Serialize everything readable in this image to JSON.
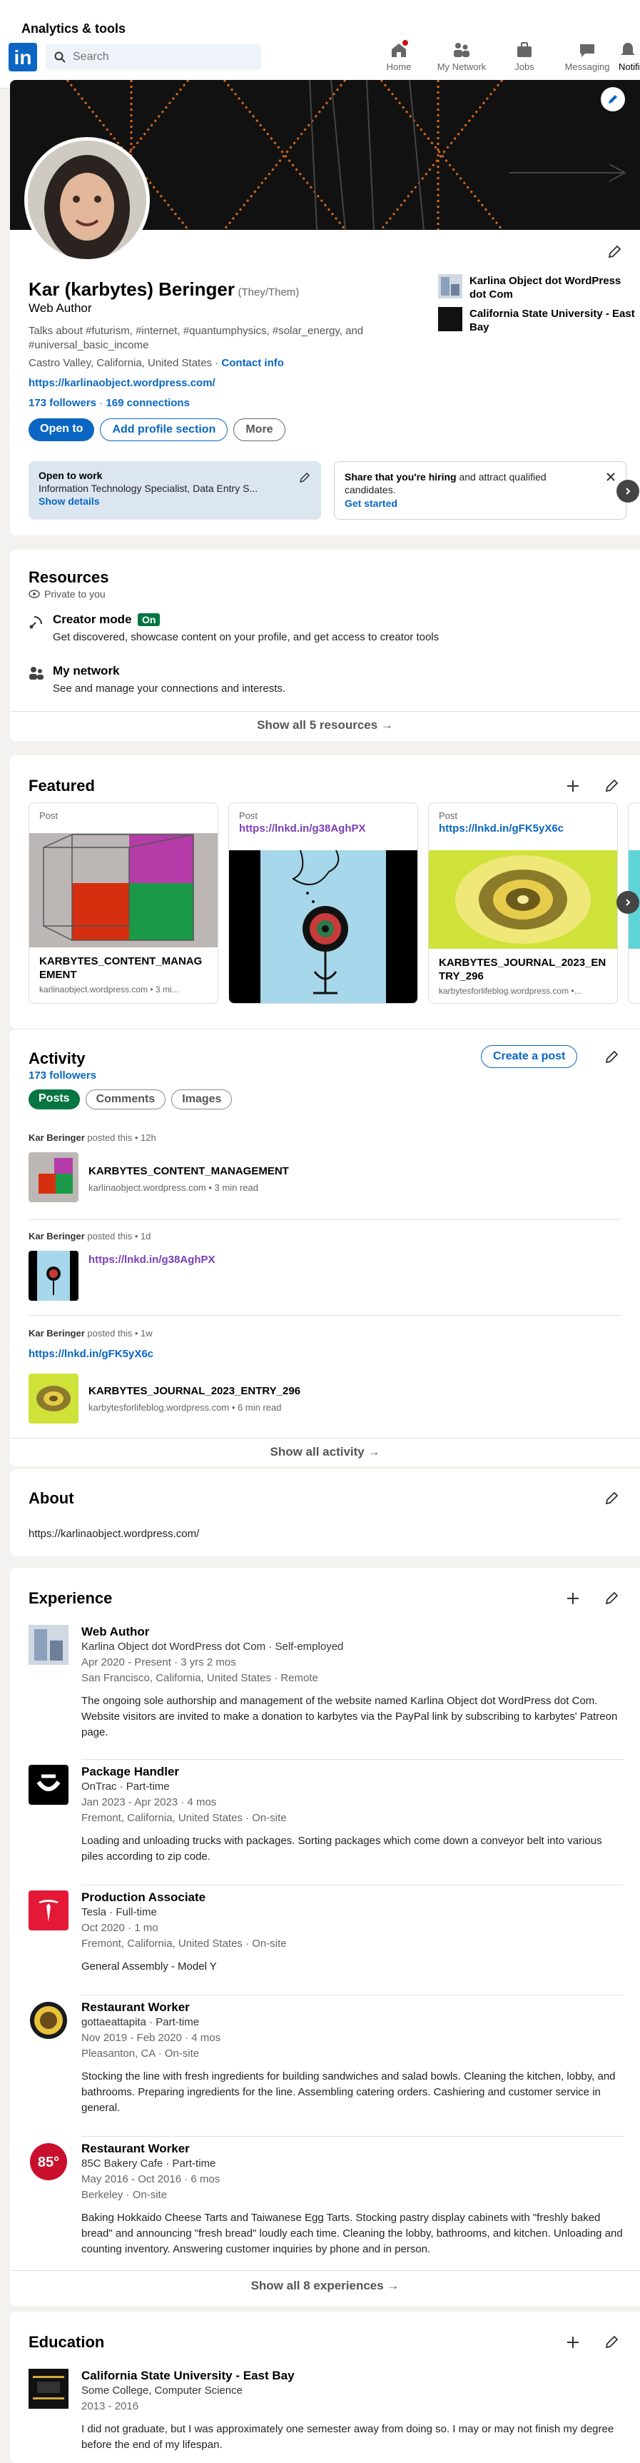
{
  "header": {
    "analytics": "Analytics & tools",
    "logo": "in",
    "search_placeholder": "Search",
    "nav": [
      {
        "label": "Home",
        "icon": "home-icon"
      },
      {
        "label": "My Network",
        "icon": "network-icon"
      },
      {
        "label": "Jobs",
        "icon": "jobs-icon"
      },
      {
        "label": "Messaging",
        "icon": "messaging-icon"
      },
      {
        "label": "Notifi",
        "icon": "notifications-icon"
      }
    ]
  },
  "profile": {
    "name": "Kar (karbytes) Beringer",
    "pronouns": "(They/Them)",
    "headline": "Web Author",
    "about_line": "Talks about #futurism, #internet, #quantumphysics, #solar_energy, and #universal_basic_income",
    "location": "Castro Valley, California, United States",
    "contact_info": "Contact info",
    "website": "https://karlinaobject.wordpress.com/",
    "followers": "173 followers",
    "connections": "169 connections",
    "open_to": "Open to",
    "add_section": "Add profile section",
    "more": "More",
    "companies": [
      "Karlina Object dot WordPress dot Com",
      "California State University - East Bay"
    ],
    "open_to_work_title": "Open to work",
    "open_to_work_desc": "Information Technology Specialist, Data Entry S...",
    "show_details": "Show details",
    "hiring_bold": "Share that you're hiring",
    "hiring_rest": " and attract qualified candidates.",
    "get_started": "Get started"
  },
  "resources": {
    "title": "Resources",
    "private": "Private to you",
    "creator_title": "Creator mode",
    "creator_badge": "On",
    "creator_desc": "Get discovered, showcase content on your profile, and get access to creator tools",
    "network_title": "My network",
    "network_desc": "See and manage your connections and interests.",
    "show_all": "Show all 5 resources →"
  },
  "featured": {
    "title": "Featured",
    "items": [
      {
        "tag": "Post",
        "title": "KARBYTES_CONTENT_MANAGEMENT",
        "sub": "karlinaobject.wordpress.com • 3 mi..."
      },
      {
        "tag": "Post",
        "link": "https://lnkd.in/g38AghPX"
      },
      {
        "tag": "Post",
        "link": "https://lnkd.in/gFK5yX6c",
        "title": "KARBYTES_JOURNAL_2023_ENTRY_296",
        "sub": "karbytesforlifeblog.wordpress.com •..."
      }
    ]
  },
  "activity": {
    "title": "Activity",
    "followers": "173 followers",
    "create_post": "Create a post",
    "filters": [
      "Posts",
      "Comments",
      "Images"
    ],
    "posts": [
      {
        "author": "Kar Beringer",
        "meta": " posted this • 12h",
        "title": "KARBYTES_CONTENT_MANAGEMENT",
        "sub": "karlinaobject.wordpress.com • 3 min read"
      },
      {
        "author": "Kar Beringer",
        "meta": " posted this • 1d",
        "link": "https://lnkd.in/g38AghPX"
      },
      {
        "author": "Kar Beringer",
        "meta": " posted this • 1w",
        "link": "https://lnkd.in/gFK5yX6c",
        "title": "KARBYTES_JOURNAL_2023_ENTRY_296",
        "sub": "karbytesforlifeblog.wordpress.com • 6 min read"
      }
    ],
    "show_all": "Show all activity →"
  },
  "about": {
    "title": "About",
    "text": "https://karlinaobject.wordpress.com/"
  },
  "experience": {
    "title": "Experience",
    "items": [
      {
        "title": "Web Author",
        "company": "Karlina Object dot WordPress dot Com · Self-employed",
        "dates": "Apr 2020 - Present · 3 yrs 2 mos",
        "location": "San Francisco, California, United States · Remote",
        "desc": "The ongoing sole authorship and management of the website named Karlina Object dot WordPress dot Com. Website visitors are invited to make a donation to karbytes via the PayPal link by subscribing to karbytes' Patreon page."
      },
      {
        "title": "Package Handler",
        "company": "OnTrac · Part-time",
        "dates": "Jan 2023 - Apr 2023 · 4 mos",
        "location": "Fremont, California, United States · On-site",
        "desc": "Loading and unloading trucks with packages. Sorting packages which come down a conveyor belt into various piles according to zip code."
      },
      {
        "title": "Production Associate",
        "company": "Tesla · Full-time",
        "dates": "Oct 2020 · 1 mo",
        "location": "Fremont, California, United States · On-site",
        "desc": "General Assembly - Model Y"
      },
      {
        "title": "Restaurant Worker",
        "company": "gottaeattapita · Part-time",
        "dates": "Nov 2019 - Feb 2020 · 4 mos",
        "location": "Pleasanton, CA · On-site",
        "desc": "Stocking the line with fresh ingredients for building sandwiches and salad bowls. Cleaning the kitchen, lobby, and bathrooms. Preparing ingredients for the line. Assembling catering orders. Cashiering and customer service in general."
      },
      {
        "title": "Restaurant Worker",
        "company": "85C Bakery Cafe · Part-time",
        "dates": "May 2016 - Oct 2016 · 6 mos",
        "location": "Berkeley · On-site",
        "desc": "Baking Hokkaido Cheese Tarts and Taiwanese Egg Tarts. Stocking pastry display cabinets with \"freshly baked bread\" and announcing \"fresh bread\" loudly each time. Cleaning the lobby, bathrooms, and kitchen. Unloading and counting inventory. Answering customer inquiries by phone and in person."
      }
    ],
    "show_all": "Show all 8 experiences →"
  },
  "education": {
    "title": "Education",
    "school": "California State University - East Bay",
    "degree": "Some College, Computer Science",
    "dates": "2013 - 2016",
    "desc": "I did not graduate, but I was approximately one semester away from doing so. I may or may not finish my degree before the end of my lifespan."
  },
  "colors": {
    "brand": "#0a66c2",
    "background": "#f3f2ef",
    "open_to_work_bg": "#dce6f1",
    "creator_on": "#057642"
  }
}
